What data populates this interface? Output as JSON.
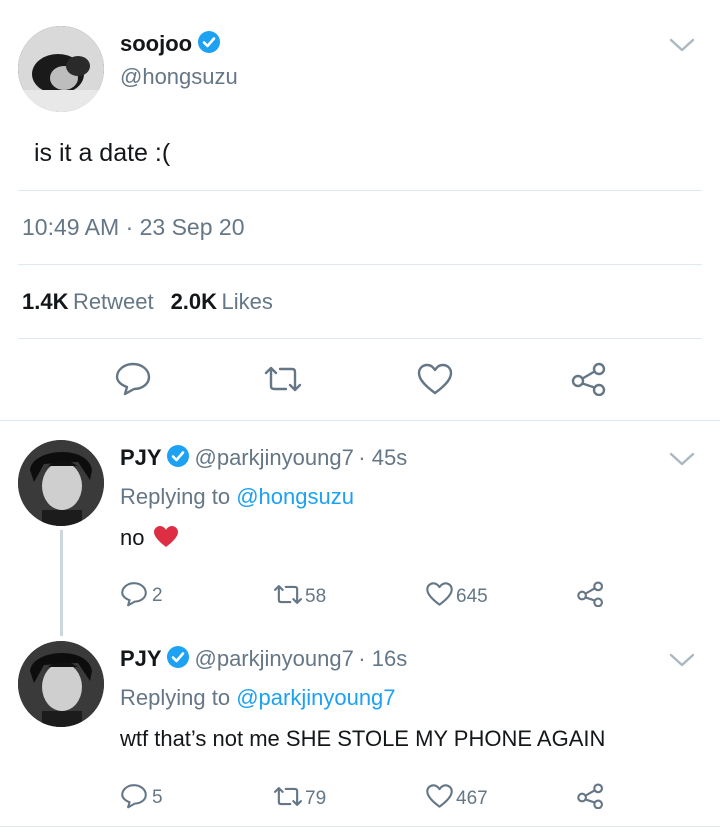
{
  "main_tweet": {
    "author_name": "soojoo",
    "author_handle": "@hongsuzu",
    "text": "is it a date :(",
    "timestamp": "10:49 AM · 23 Sep 20",
    "retweet_count": "1.4K",
    "retweet_label": "Retweet",
    "like_count": "2.0K",
    "like_label": "Likes"
  },
  "replies": [
    {
      "author_name": "PJY",
      "author_handle": "@parkjinyoung7",
      "time": "· 45s",
      "replying_prefix": "Replying to",
      "replying_to": "@hongsuzu",
      "text": "no",
      "emoji": "❤️",
      "reply_count": "2",
      "retweet_count": "58",
      "like_count": "645"
    },
    {
      "author_name": "PJY",
      "author_handle": "@parkjinyoung7",
      "time": "· 16s",
      "replying_prefix": "Replying to",
      "replying_to": "@parkjinyoung7",
      "text": "wtf that’s not me SHE STOLE MY PHONE AGAIN",
      "reply_count": "5",
      "retweet_count": "79",
      "like_count": "467"
    }
  ],
  "colors": {
    "accent": "#1da1f2",
    "secondary_text": "#657786",
    "divider": "#e1e8ed",
    "heart": "#e0245e"
  },
  "icons": [
    "verified-badge-icon",
    "chevron-down-icon",
    "reply-icon",
    "retweet-icon",
    "like-icon",
    "share-icon"
  ]
}
